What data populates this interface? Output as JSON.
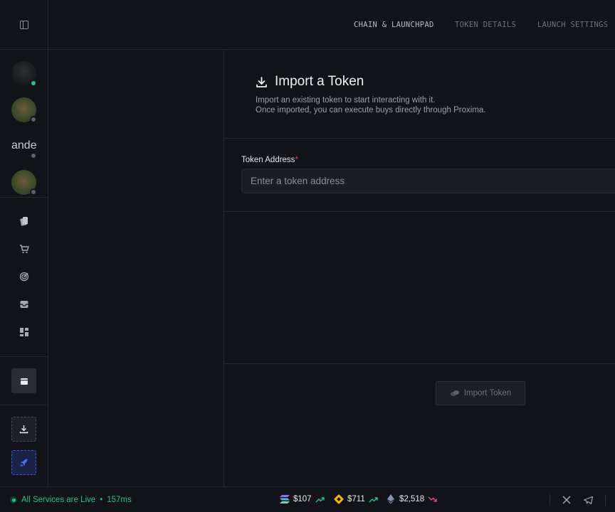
{
  "steps": [
    {
      "label": "CHAIN & LAUNCHPAD",
      "active": true
    },
    {
      "label": "TOKEN DETAILS",
      "active": false
    },
    {
      "label": "LAUNCH SETTINGS",
      "active": false
    }
  ],
  "sidebar": {
    "avatars": [
      {
        "kind": "image",
        "status": "online"
      },
      {
        "kind": "image",
        "status": "offline"
      },
      {
        "kind": "text",
        "text": "ande",
        "status": "offline"
      },
      {
        "kind": "image",
        "status": "offline"
      }
    ],
    "nav_icons": [
      "cards-icon",
      "cart-icon",
      "radar-icon",
      "inbox-icon",
      "dashboard-icon"
    ],
    "actions": [
      "wallet-icon",
      "download-icon",
      "rocket-icon"
    ]
  },
  "import": {
    "title": "Import a Token",
    "desc_line1": "Import an existing token to start interacting with it.",
    "desc_line2": "Once imported, you can execute buys directly through Proxima.",
    "field_label": "Token Address",
    "required_mark": "*",
    "placeholder": "Enter a token address",
    "button": "Import Token"
  },
  "status": {
    "live_text": "All Services are Live",
    "separator": "•",
    "latency": "157ms",
    "prices": [
      {
        "coin": "solana-icon",
        "value": "$107",
        "trend": "up"
      },
      {
        "coin": "bnb-icon",
        "value": "$711",
        "trend": "up"
      },
      {
        "coin": "ethereum-icon",
        "value": "$2,518",
        "trend": "down"
      }
    ]
  },
  "colors": {
    "up": "#26c281",
    "down": "#e5487d",
    "accent_blue": "#3b5bdb"
  }
}
